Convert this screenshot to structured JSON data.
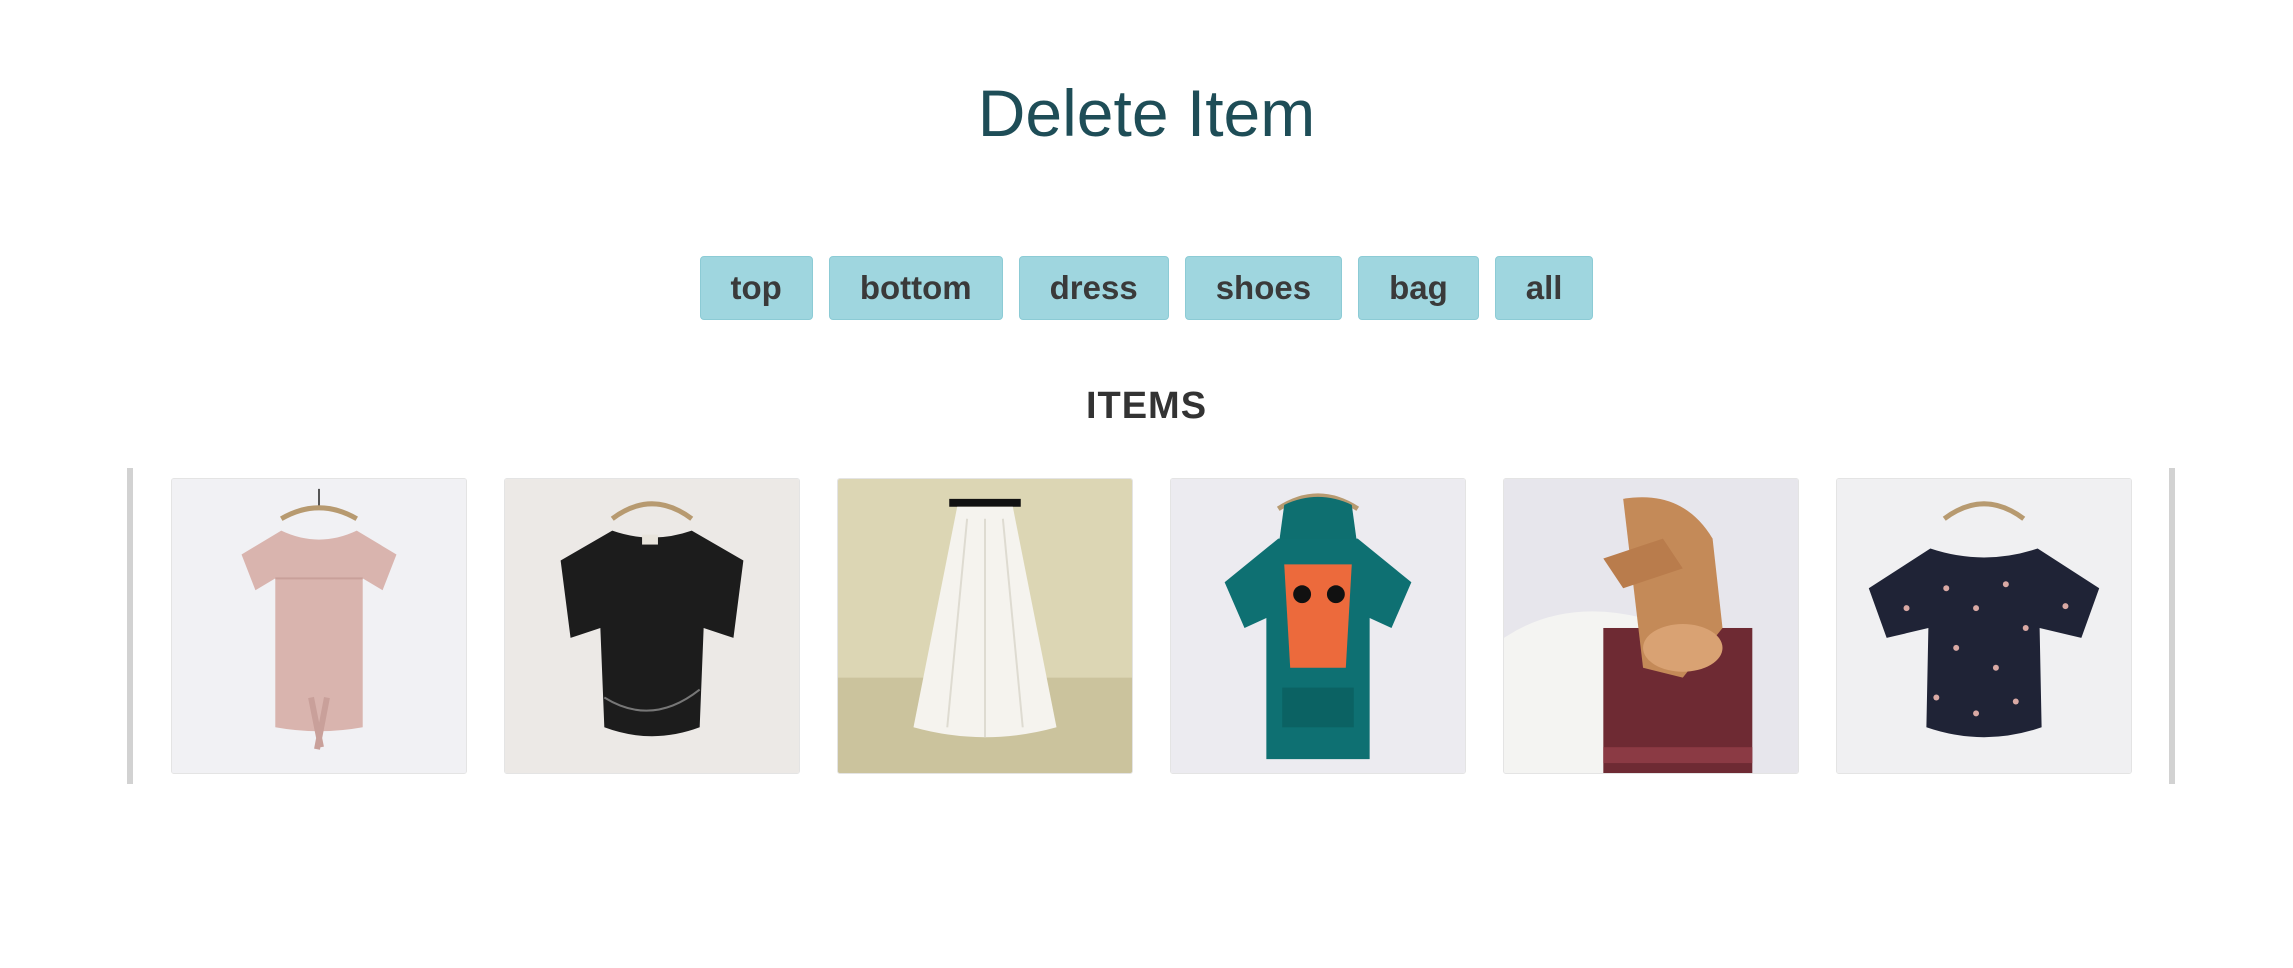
{
  "page": {
    "title": "Delete Item",
    "section_heading": "ITEMS"
  },
  "filters": [
    {
      "label": "top"
    },
    {
      "label": "bottom"
    },
    {
      "label": "dress"
    },
    {
      "label": "shoes"
    },
    {
      "label": "bag"
    },
    {
      "label": "all"
    }
  ],
  "colors": {
    "title": "#1e4d57",
    "filter_button_bg": "#9fd6df",
    "filter_button_text": "#3a3a3a",
    "carousel_border": "#d2d2d2"
  },
  "items": [
    {
      "name": "pink-striped-tee-image",
      "description_icon": "pink-tshirt"
    },
    {
      "name": "black-peplum-top-image",
      "description_icon": "black-top"
    },
    {
      "name": "white-skirt-image",
      "description_icon": "white-skirt"
    },
    {
      "name": "teal-hoodie-image",
      "description_icon": "teal-hoodie"
    },
    {
      "name": "tan-sandals-image",
      "description_icon": "tan-sandals"
    },
    {
      "name": "floral-blouse-image",
      "description_icon": "floral-blouse"
    }
  ]
}
